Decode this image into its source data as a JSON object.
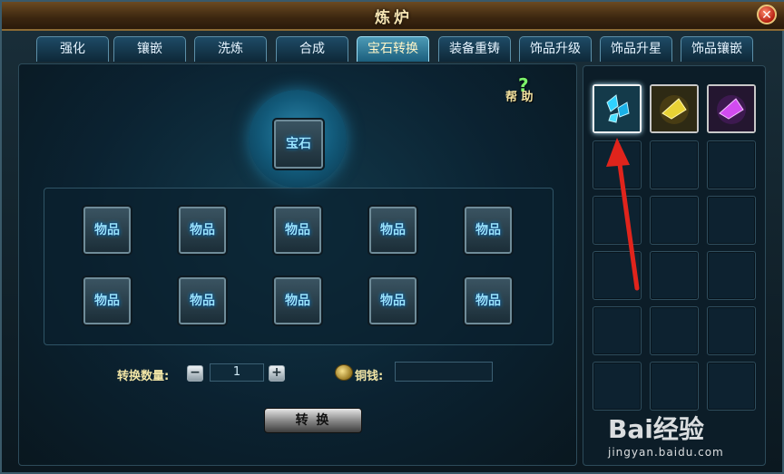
{
  "window": {
    "title": "炼炉",
    "close_label": "✕"
  },
  "tabs": [
    {
      "label": "强化"
    },
    {
      "label": "镶嵌"
    },
    {
      "label": "洗炼"
    },
    {
      "label": "合成"
    },
    {
      "label": "宝石转换",
      "active": true
    },
    {
      "label": "装备重铸"
    },
    {
      "label": "饰品升级"
    },
    {
      "label": "饰品升星"
    },
    {
      "label": "饰品镶嵌"
    }
  ],
  "help": {
    "icon": "question-icon",
    "label": "帮 助"
  },
  "gem_slot": {
    "label": "宝石"
  },
  "item_slots": [
    "物品",
    "物品",
    "物品",
    "物品",
    "物品",
    "物品",
    "物品",
    "物品",
    "物品",
    "物品"
  ],
  "quantity": {
    "label": "转换数量:",
    "minus": "−",
    "plus": "+",
    "value": "1"
  },
  "coins": {
    "label": "铜钱:",
    "value": ""
  },
  "convert_button": "转 换",
  "inventory": {
    "gems": [
      {
        "name": "blue-gem-icon",
        "color": "#2fd2ff"
      },
      {
        "name": "yellow-gem-icon",
        "color": "#e8d235"
      },
      {
        "name": "purple-gem-icon",
        "color": "#d24bf0"
      }
    ],
    "empty_slots": 15
  },
  "watermark": {
    "logo": "Bai经验",
    "url": "jingyan.baidu.com"
  },
  "colors": {
    "accent": "#9ae6ff",
    "arrow": "#e0241c",
    "active_tab": "#4c9ab6"
  }
}
